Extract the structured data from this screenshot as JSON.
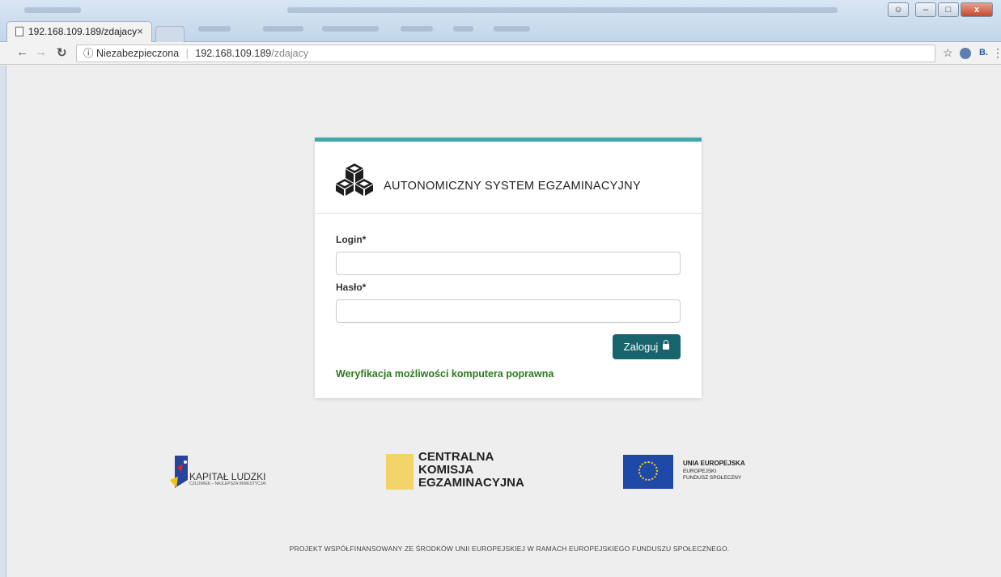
{
  "browser": {
    "tab_title": "192.168.109.189/zdajacy",
    "tab_close": "×",
    "security_label": "Niezabezpieczona",
    "url_host": "192.168.109.189",
    "url_path": "/zdajacy",
    "window_buttons": {
      "minimize": "–",
      "maximize": "□",
      "close": "x"
    }
  },
  "login": {
    "title": "AUTONOMICZNY SYSTEM EGZAMINACYJNY",
    "login_label": "Login*",
    "password_label": "Hasło*",
    "submit_label": "Zaloguj",
    "verification_text": "Weryfikacja możliwości komputera poprawna",
    "accent_color": "#3fa8ab",
    "button_color": "#17646d",
    "verification_color": "#2b7a1c"
  },
  "logos": {
    "kapital_ludzki": {
      "title": "KAPITAŁ LUDZKI",
      "subtitle": "CZŁOWIEK – NAJLEPSZA INWESTYCJA!"
    },
    "cke": {
      "line1": "CENTRALNA",
      "line2": "KOMISJA",
      "line3": "EGZAMINACYJNA"
    },
    "ue": {
      "title": "UNIA EUROPEJSKA",
      "line1": "EUROPEJSKI",
      "line2": "FUNDUSZ SPOŁECZNY"
    }
  },
  "footer": {
    "text": "PROJEKT WSPÓŁFINANSOWANY ZE ŚRODKÓW UNII EUROPEJSKIEJ W RAMACH EUROPEJSKIEGO FUNDUSZU SPOŁECZNEGO."
  }
}
